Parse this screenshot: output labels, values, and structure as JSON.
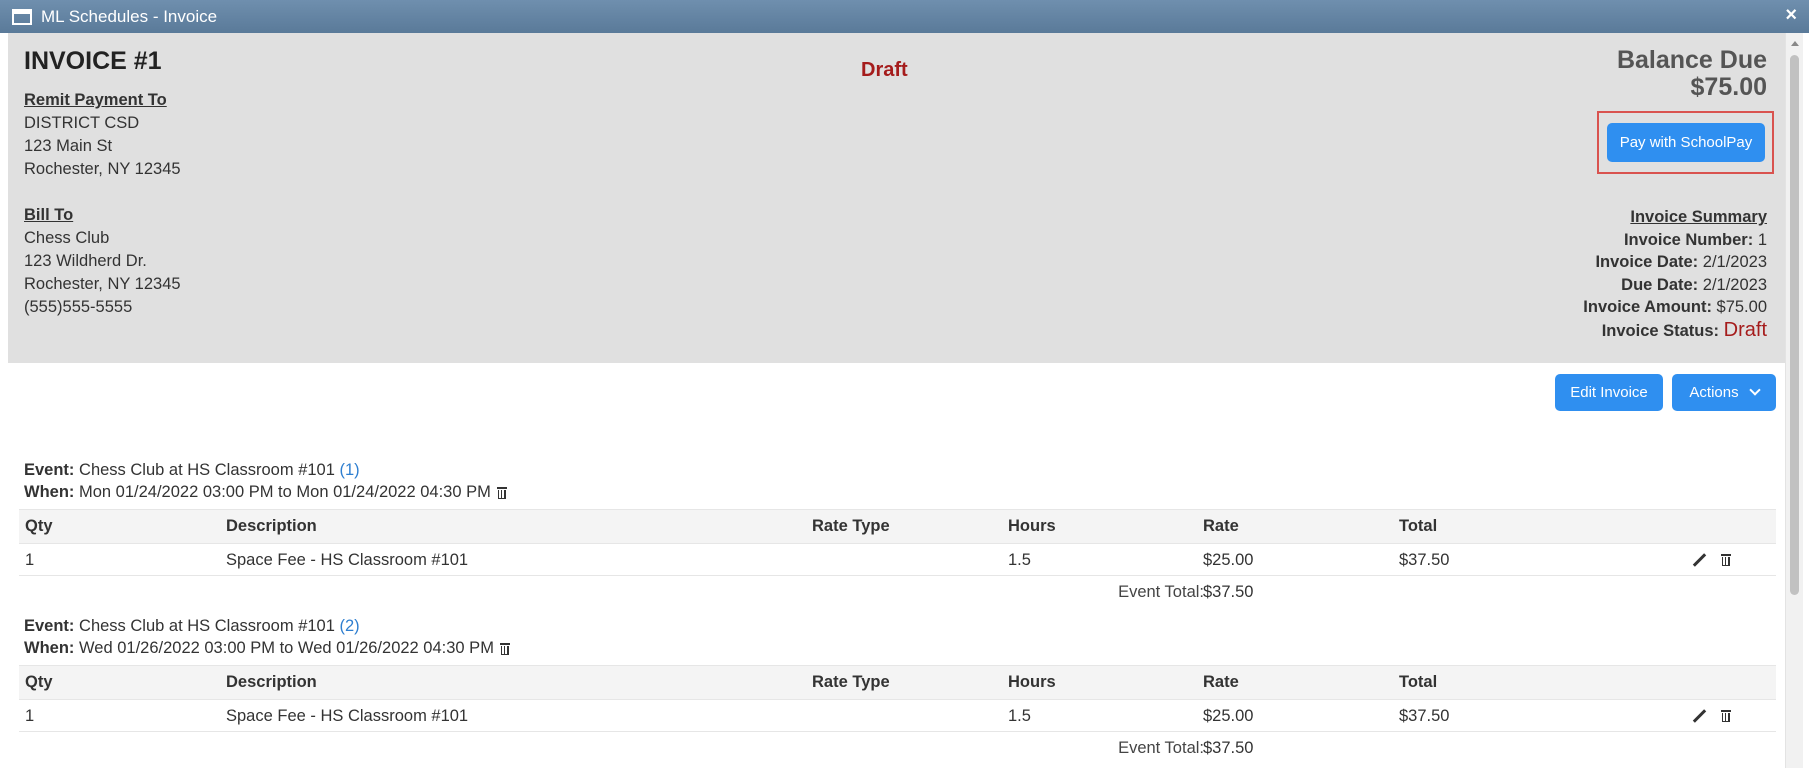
{
  "window": {
    "title": "ML Schedules - Invoice",
    "close_label": "×"
  },
  "invoice": {
    "title": "INVOICE #1",
    "status_banner": "Draft",
    "balance_label": "Balance Due",
    "balance_amount": "$75.00",
    "pay_button": "Pay with SchoolPay",
    "remit": {
      "heading": "Remit Payment To",
      "lines": [
        "DISTRICT CSD",
        "123 Main St",
        "Rochester, NY 12345"
      ]
    },
    "bill_to": {
      "heading": "Bill To",
      "lines": [
        "Chess Club",
        "123 Wildherd Dr.",
        "Rochester, NY 12345",
        "(555)555-5555"
      ]
    },
    "summary": {
      "heading": "Invoice Summary",
      "items": [
        {
          "label": "Invoice Number:",
          "value": "1"
        },
        {
          "label": "Invoice Date:",
          "value": "2/1/2023"
        },
        {
          "label": "Due Date:",
          "value": "2/1/2023"
        },
        {
          "label": "Invoice Amount:",
          "value": "$75.00"
        },
        {
          "label": "Invoice Status:",
          "value": "Draft"
        }
      ]
    }
  },
  "toolbar": {
    "edit_label": "Edit Invoice",
    "actions_label": "Actions"
  },
  "table_headers": [
    "Qty",
    "Description",
    "Rate Type",
    "Hours",
    "Rate",
    "Total"
  ],
  "events": [
    {
      "event_label": "Event:",
      "event_name": "Chess Club at HS Classroom #101",
      "event_num": "(1)",
      "when_label": "When:",
      "when": "Mon 01/24/2022 03:00 PM to Mon 01/24/2022 04:30 PM",
      "rows": [
        {
          "qty": "1",
          "description": "Space Fee - HS Classroom #101",
          "rate_type": "",
          "hours": "1.5",
          "rate": "$25.00",
          "total": "$37.50"
        }
      ],
      "total_label": "Event Total:",
      "total_value": "$37.50"
    },
    {
      "event_label": "Event:",
      "event_name": "Chess Club at HS Classroom #101",
      "event_num": "(2)",
      "when_label": "When:",
      "when": "Wed 01/26/2022 03:00 PM to Wed 01/26/2022 04:30 PM",
      "rows": [
        {
          "qty": "1",
          "description": "Space Fee - HS Classroom #101",
          "rate_type": "",
          "hours": "1.5",
          "rate": "$25.00",
          "total": "$37.50"
        }
      ],
      "total_label": "Event Total:",
      "total_value": "$37.50"
    }
  ],
  "colors": {
    "primary_button": "#2f8ff0",
    "draft_red": "#a51c1c",
    "highlight_border": "#d9534f",
    "header_panel": "#e0e0e0"
  }
}
